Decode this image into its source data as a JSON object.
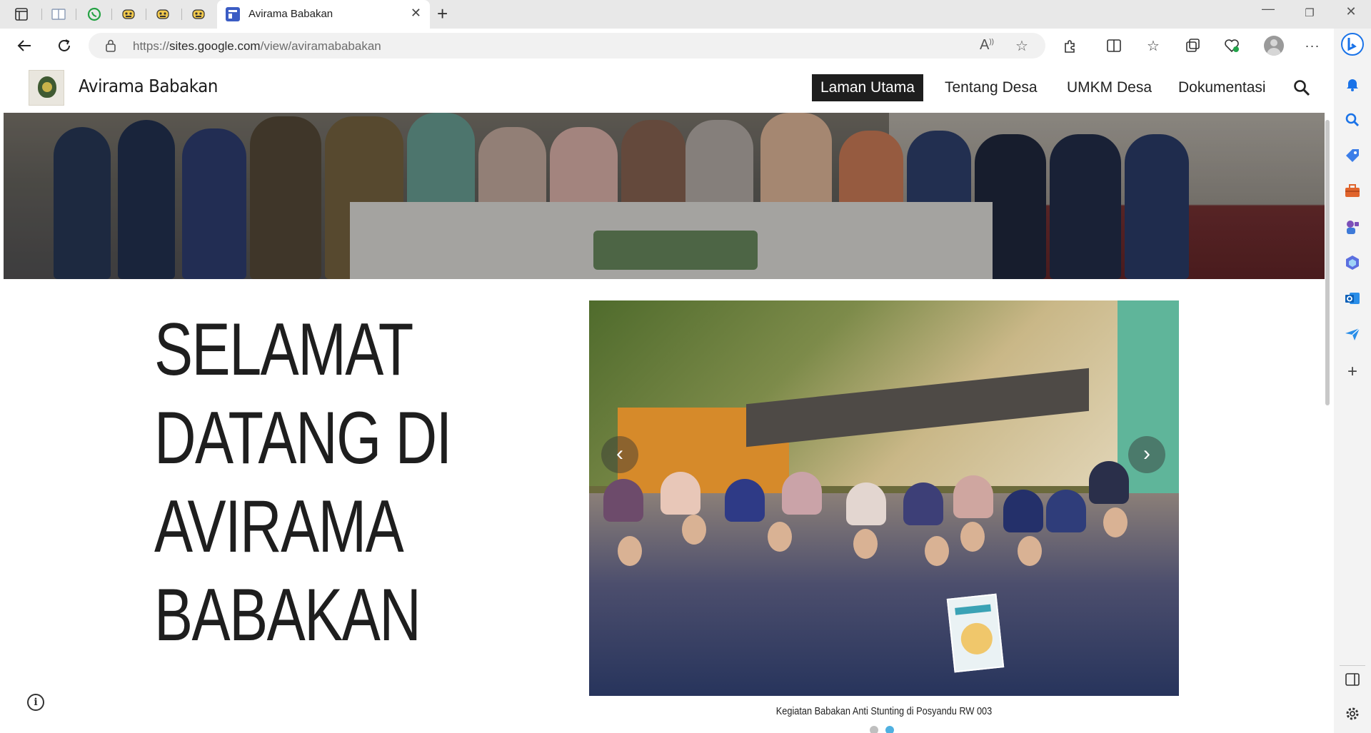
{
  "browser": {
    "active_tab_title": "Avirama Babakan",
    "url_prefix": "https://",
    "url_host": "sites.google.com",
    "url_path": "/view/aviramababakan",
    "pinned_tab_icons": [
      "sidebar-toggle-icon",
      "reading-list-icon",
      "whatsapp-icon",
      "bot-icon",
      "bot-icon",
      "bot-icon"
    ]
  },
  "site": {
    "title": "Avirama Babakan",
    "nav": [
      {
        "label": "Laman Utama",
        "active": true
      },
      {
        "label": "Tentang Desa",
        "active": false
      },
      {
        "label": "UMKM Desa",
        "active": false
      },
      {
        "label": "Dokumentasi",
        "active": false
      }
    ]
  },
  "hero": {
    "heading_lines": [
      "SELAMAT",
      "DATANG DI",
      "AVIRAMA",
      "BABAKAN"
    ]
  },
  "carousel": {
    "caption": "Kegiatan Babakan Anti Stunting di Posyandu RW 003",
    "slide_count": 2,
    "active_slide": 2
  },
  "colors": {
    "nav_active_bg": "#1e1e1e",
    "dot_active": "#4fb0e0",
    "edge_accent": "#1a73e8"
  }
}
